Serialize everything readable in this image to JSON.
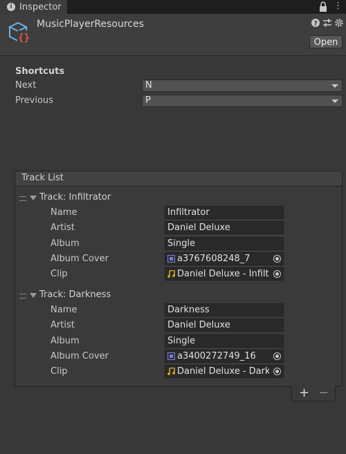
{
  "window": {
    "tab_label": "Inspector",
    "tab_icon": "info-icon",
    "tab_menu_glyph": "⋮"
  },
  "asset": {
    "title": "MusicPlayerResources",
    "icon": "script-asset-icon",
    "open_label": "Open"
  },
  "shortcuts": {
    "label": "Shortcuts",
    "next_label": "Next",
    "next_value": "N",
    "previous_label": "Previous",
    "previous_value": "P"
  },
  "track_list": {
    "title": "Track List",
    "field_labels": {
      "name": "Name",
      "artist": "Artist",
      "album": "Album",
      "album_cover": "Album Cover",
      "clip": "Clip"
    },
    "tracks": [
      {
        "title": "Track: Infiltrator",
        "name": "Infiltrator",
        "artist": "Daniel Deluxe",
        "album": "Single",
        "album_cover": "a3767608248_7",
        "clip": "Daniel Deluxe - Infiltrator"
      },
      {
        "title": "Track: Darkness",
        "name": "Darkness",
        "artist": "Daniel Deluxe",
        "album": "Single",
        "album_cover": "a3400272749_16",
        "clip": "Daniel Deluxe - Darkness"
      }
    ],
    "add_label": "+",
    "remove_label": "−"
  },
  "colors": {
    "background": "#383838",
    "field": "#2a2a2a",
    "sprite_icon": "#7b7bd6",
    "audio_icon": "#e0b020",
    "asset_icon_blue": "#6ab0e8",
    "asset_icon_red": "#e8553d"
  }
}
